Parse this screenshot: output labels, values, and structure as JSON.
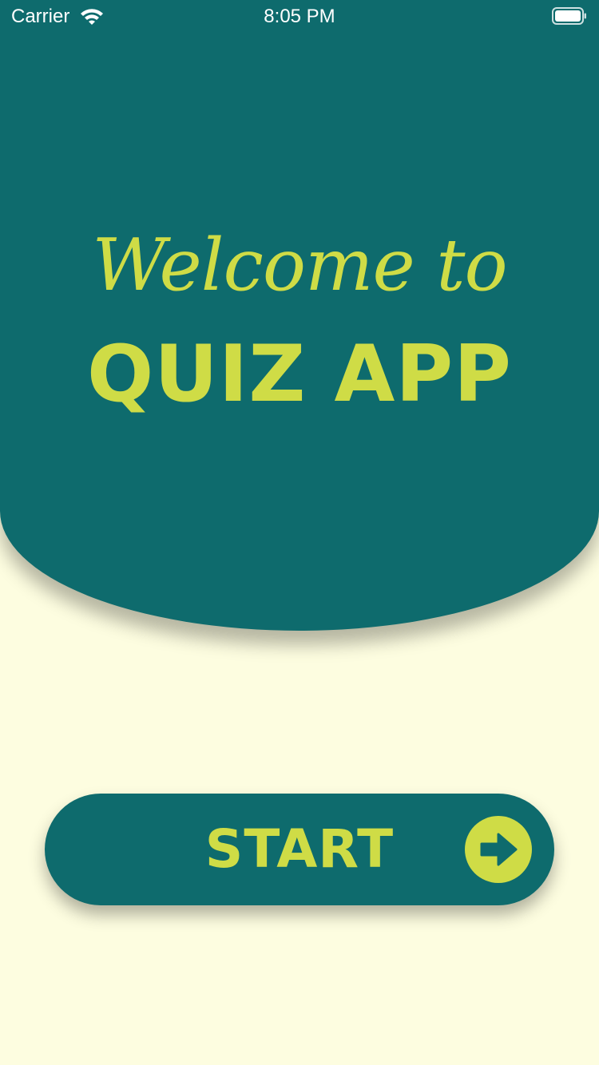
{
  "status_bar": {
    "carrier": "Carrier",
    "time": "8:05 PM",
    "wifi_icon": "wifi-icon",
    "battery_icon": "battery-icon"
  },
  "header": {
    "welcome_text": "Welcome to",
    "app_title": "QUIZ APP"
  },
  "start_button": {
    "label": "START",
    "icon": "arrow-right-circle-icon"
  },
  "colors": {
    "primary": "#0e6b6d",
    "accent": "#cfdc46",
    "background": "#fdfde0",
    "status_text": "#ffffff"
  }
}
